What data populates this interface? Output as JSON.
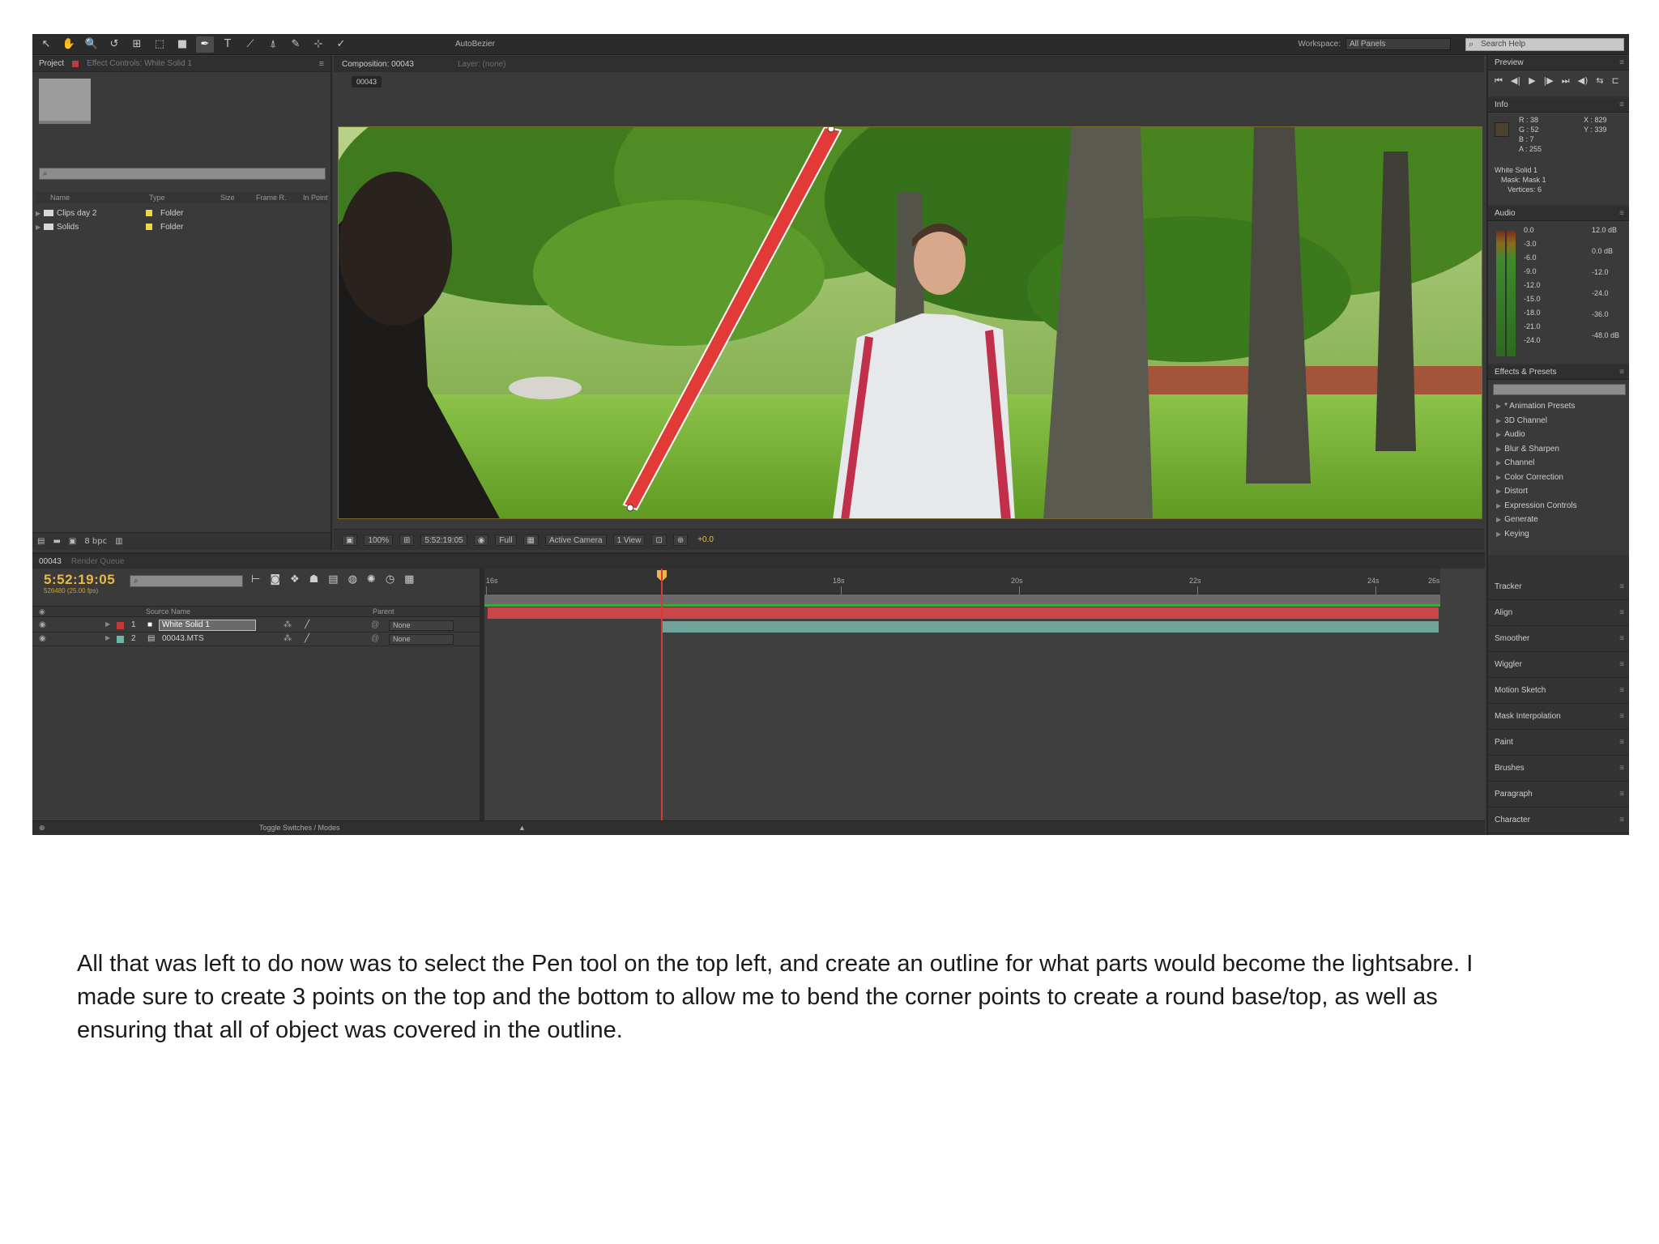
{
  "toolbar": {
    "tools": [
      "↖",
      "✋",
      "🔍",
      "↺",
      "⊞",
      "⬚",
      "■",
      "✒",
      "T",
      "⟋",
      "⍋",
      "✎",
      "⊹",
      "✓"
    ],
    "autoorient_label": "AutoBezier",
    "workspace_label": "Workspace:",
    "workspace_value": "All Panels",
    "search_placeholder": "Search Help"
  },
  "project": {
    "tab_project": "Project",
    "tab_effect_controls": "Effect Controls: White Solid 1",
    "columns": [
      "Name",
      "Type",
      "Size",
      "Frame R.",
      "In Point"
    ],
    "items": [
      {
        "name": "Clips day 2",
        "type": "Folder"
      },
      {
        "name": "Solids",
        "type": "Folder"
      }
    ],
    "bpc": "8 bpc"
  },
  "composition": {
    "tab_comp": "Composition: 00043",
    "tab_layer": "Layer: (none)",
    "comp_chip": "00043",
    "footer": {
      "zoom": "100%",
      "timecode": "5:52:19:05",
      "resolution": "Full",
      "camera": "Active Camera",
      "views": "1 View",
      "exposure": "+0.0"
    }
  },
  "preview": {
    "title": "Preview",
    "controls": [
      "⏮",
      "◀|",
      "▶",
      "|▶",
      "⏭",
      "◀)",
      "⇆",
      "⊏"
    ]
  },
  "info": {
    "title": "Info",
    "r": "R : 38",
    "g": "G : 52",
    "b": "B : 7",
    "a": "A : 255",
    "x": "X : 829",
    "y": "Y : 339",
    "layer": "White Solid 1",
    "mask": "Mask: Mask 1",
    "vertices": "Vertices: 6"
  },
  "audio": {
    "title": "Audio",
    "left_scale": [
      "0.0",
      "-3.0",
      "-6.0",
      "-9.0",
      "-12.0",
      "-15.0",
      "-18.0",
      "-21.0",
      "-24.0"
    ],
    "right_scale": [
      "12.0 dB",
      "0.0 dB",
      "-12.0",
      "-24.0",
      "-36.0",
      "-48.0 dB"
    ]
  },
  "effects": {
    "title": "Effects & Presets",
    "items": [
      "* Animation Presets",
      "3D Channel",
      "Audio",
      "Blur & Sharpen",
      "Channel",
      "Color Correction",
      "Distort",
      "Expression Controls",
      "Generate",
      "Keying"
    ]
  },
  "mini_panels": [
    "Tracker",
    "Align",
    "Smoother",
    "Wiggler",
    "Motion Sketch",
    "Mask Interpolation",
    "Paint",
    "Brushes",
    "Paragraph",
    "Character"
  ],
  "timeline": {
    "tab_comp": "00043",
    "tab_render": "Render Queue",
    "timecode": "5:52:19:05",
    "fps": "526480 (25.00 fps)",
    "head_source": "Source Name",
    "head_parent": "Parent",
    "layers": [
      {
        "num": "1",
        "name": "White Solid 1",
        "parent": "None",
        "color": "#c43a3a"
      },
      {
        "num": "2",
        "name": "00043.MTS",
        "parent": "None",
        "color": "#6fb3a8"
      }
    ],
    "ruler": [
      "16s",
      "18s",
      "20s",
      "22s",
      "24s",
      "26s"
    ],
    "footer": "Toggle Switches / Modes"
  },
  "caption": "All that was left to do now was to select the Pen tool on the top left, and create an outline for what parts would become the lightsabre. I made sure to create 3 points on the top and the bottom to allow me to bend the corner points to create a round base/top, as well as ensuring that all of object was covered in the outline."
}
